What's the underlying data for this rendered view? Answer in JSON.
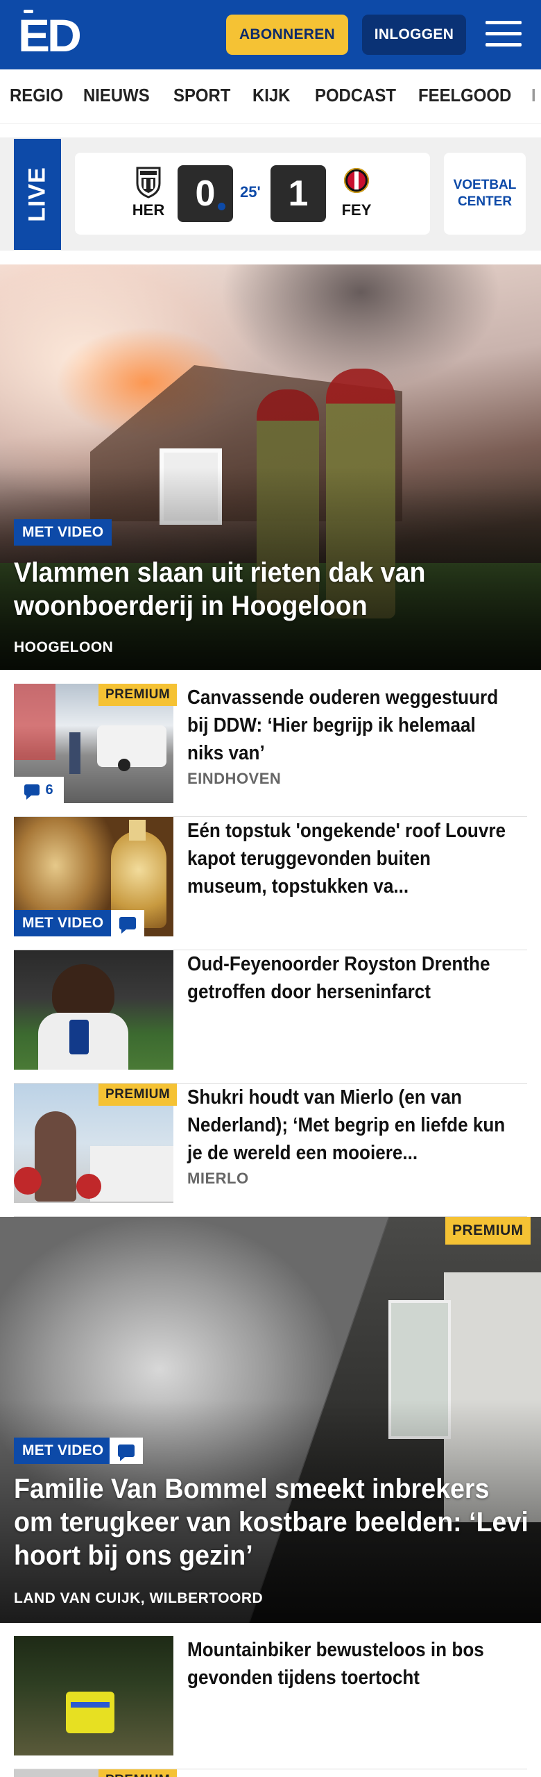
{
  "header": {
    "logo": "ED",
    "subscribe_label": "ABONNEREN",
    "login_label": "INLOGGEN",
    "menu_icon": "hamburger-menu-icon",
    "brand_color": "#0d4aa8",
    "accent_color": "#f5c234"
  },
  "nav": {
    "items": [
      "REGIO",
      "NIEUWS",
      "SPORT",
      "KIJK",
      "PODCAST",
      "FEELGOOD",
      "I"
    ]
  },
  "live": {
    "label": "LIVE",
    "home_team": "HER",
    "away_team": "FEY",
    "home_score": "0",
    "away_score": "1",
    "minute": "25'",
    "center_label": "VOETBAL CENTER"
  },
  "hero": {
    "badge": "MET VIDEO",
    "title": "Vlammen slaan uit rieten dak van woonboerderij in Hoogeloon",
    "location": "HOOGELOON"
  },
  "articles": [
    {
      "premium": "PREMIUM",
      "comments": "6",
      "title": "Canvassende ouderen wegge­stuurd bij DDW: ‘Hier begrijp ik helemaal niks van’",
      "location": "EINDHOVEN"
    },
    {
      "badge": "MET VIDEO",
      "title": "Eén topstuk 'ongekende' roof Louvre kapot teruggevonden buiten museum, topstukken va..."
    },
    {
      "title": "Oud-Feyenoorder Royston Drenthe getroffen door hersenin­farct"
    },
    {
      "premium": "PREMIUM",
      "title": "Shukri houdt van Mierlo (en van Nederland); ‘Met begrip en liefde kun je de wereld een mooiere...",
      "location": "MIERLO"
    }
  ],
  "big_article": {
    "premium": "PREMIUM",
    "badge": "MET VIDEO",
    "title": "Familie Van Bommel smeekt inbrekers om terugkeer van kostbare beelden: ‘Levi hoort bij ons gezin’",
    "location": "LAND VAN CUIJK, WILBERTOORD"
  },
  "articles_bottom": [
    {
      "title": "Mountainbiker bewusteloos in bos gevonden tijdens toertocht"
    },
    {
      "premium": "PREMIUM"
    }
  ]
}
